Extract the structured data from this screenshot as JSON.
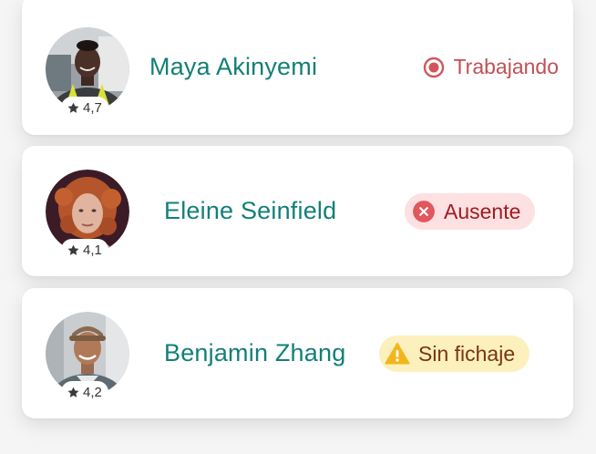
{
  "employees": [
    {
      "name": "Maya Akinyemi",
      "rating": "4,7",
      "status": {
        "label": "Trabajando",
        "type": "working",
        "icon": "record-circle-icon",
        "color": "#c05055"
      }
    },
    {
      "name": "Eleine Seinfield",
      "rating": "4,1",
      "status": {
        "label": "Ausente",
        "type": "absent",
        "icon": "x-circle-icon",
        "color": "#9f1c22",
        "background": "#fde0e1"
      }
    },
    {
      "name": "Benjamin Zhang",
      "rating": "4,2",
      "status": {
        "label": "Sin fichaje",
        "type": "no-check-in",
        "icon": "warning-triangle-icon",
        "color": "#7a3411",
        "background": "#fcf0bd"
      }
    }
  ],
  "colors": {
    "name": "#137f78",
    "card": "#ffffff",
    "page": "#f5f5f6"
  }
}
